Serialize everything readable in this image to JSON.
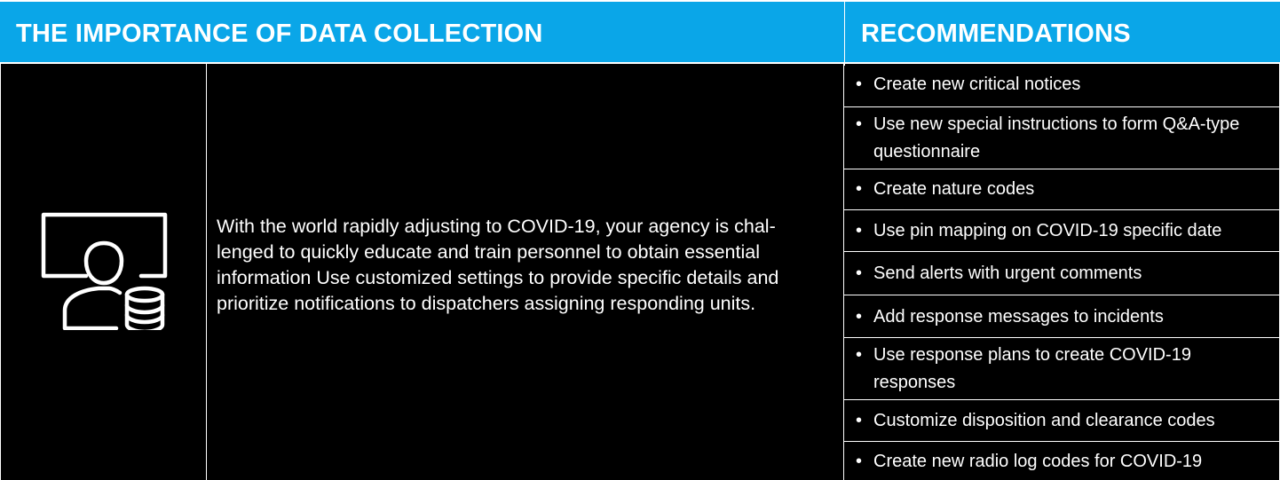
{
  "header": {
    "left_title": "THE IMPORTANCE OF DATA COLLECTION",
    "right_title": "RECOMMENDATIONS"
  },
  "description": {
    "lines": [
      "With the world rapidly adjusting to COVID-19, your agency is chal-",
      "lenged to quickly educate and  train personnel to obtain essential",
      "information Use customized settings to provide specific details and",
      "prioritize notifications to dispatchers assigning responding units."
    ]
  },
  "icon": {
    "name": "user-monitor-database-icon"
  },
  "recommendations": [
    {
      "bullet": "•",
      "lines": [
        "Create new critical notices"
      ]
    },
    {
      "bullet": "•",
      "lines": [
        "Use new special instructions to form Q&A-type",
        "questionnaire"
      ]
    },
    {
      "bullet": "•",
      "lines": [
        "Create nature codes"
      ]
    },
    {
      "bullet": "•",
      "lines": [
        "Use pin mapping on COVID-19 specific date"
      ]
    },
    {
      "bullet": "•",
      "lines": [
        "Send alerts with urgent comments"
      ]
    },
    {
      "bullet": "•",
      "lines": [
        "Add response messages to incidents"
      ]
    },
    {
      "bullet": "•",
      "lines": [
        "Use response plans to create COVID-19",
        "responses"
      ]
    },
    {
      "bullet": "•",
      "lines": [
        "Customize disposition and clearance codes"
      ]
    },
    {
      "bullet": "•",
      "lines": [
        "Create new radio log codes for COVID-19"
      ]
    }
  ],
  "colors": {
    "header_bg": "#0aa6e8",
    "page_bg": "#000000",
    "text": "#ffffff"
  }
}
